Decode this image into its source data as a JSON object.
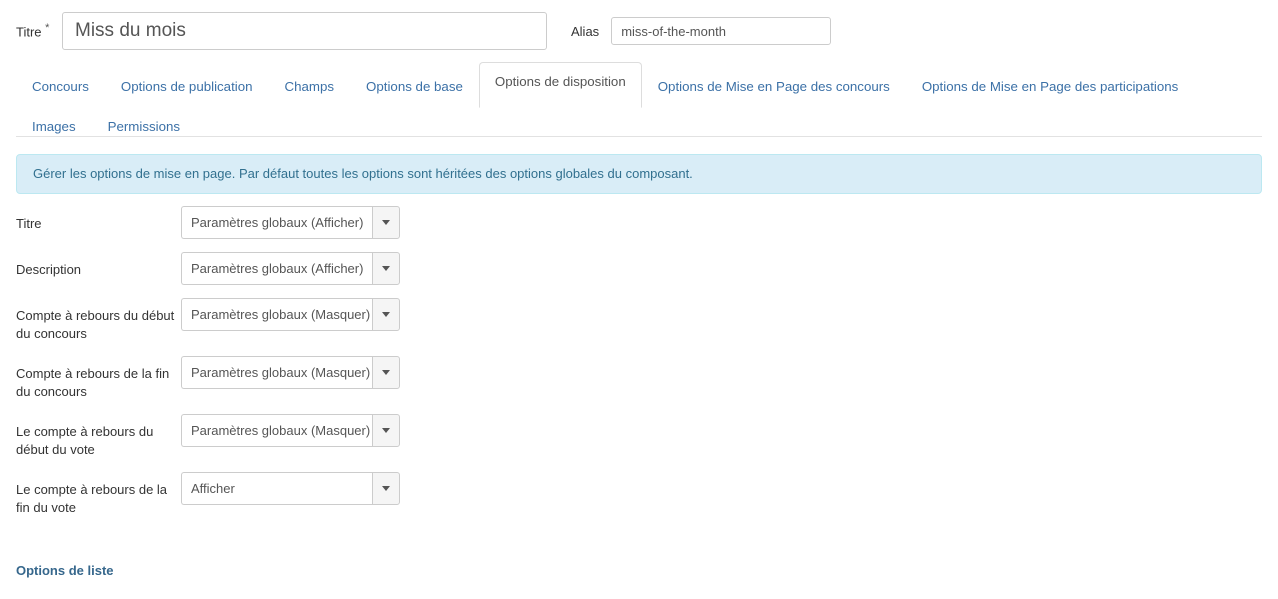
{
  "header": {
    "title_label": "Titre",
    "title_required_mark": "*",
    "title_value": "Miss du mois",
    "title_placeholder": "Titre",
    "alias_label": "Alias",
    "alias_value": "miss-of-the-month",
    "alias_placeholder": "Alias"
  },
  "tabs": [
    {
      "label": "Concours",
      "active": false
    },
    {
      "label": "Options de publication",
      "active": false
    },
    {
      "label": "Champs",
      "active": false
    },
    {
      "label": "Options de base",
      "active": false
    },
    {
      "label": "Options de disposition",
      "active": true
    },
    {
      "label": "Options de Mise en Page des concours",
      "active": false
    },
    {
      "label": "Options de Mise en Page des participations",
      "active": false
    },
    {
      "label": "Images",
      "active": false
    },
    {
      "label": "Permissions",
      "active": false
    }
  ],
  "alert": {
    "text": "Gérer les options de mise en page. Par défaut toutes les options sont héritées des options globales du composant."
  },
  "form": {
    "rows": [
      {
        "label": "Titre",
        "value": "Paramètres globaux (Afficher)"
      },
      {
        "label": "Description",
        "value": "Paramètres globaux (Afficher)"
      },
      {
        "label": "Compte à rebours du début du concours",
        "value": "Paramètres globaux (Masquer)"
      },
      {
        "label": "Compte à rebours de la fin du concours",
        "value": "Paramètres globaux (Masquer)"
      },
      {
        "label": "Le compte à rebours du début du vote",
        "value": "Paramètres globaux (Masquer)"
      },
      {
        "label": "Le compte à rebours de la fin du vote",
        "value": "Afficher"
      }
    ]
  },
  "section": {
    "list_options_heading": "Options de liste"
  },
  "colors": {
    "link": "#3c71a7",
    "alert_bg": "#d9edf7",
    "alert_border": "#bce8f1",
    "alert_text": "#31708f",
    "heading": "#36678c",
    "border": "#cccccc"
  }
}
